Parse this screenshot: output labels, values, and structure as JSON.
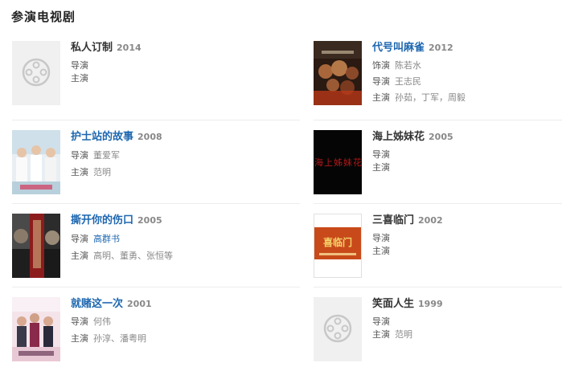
{
  "section": {
    "title": "参演电视剧"
  },
  "entries": [
    {
      "title": "私人订制",
      "year": "2014",
      "rows": [
        {
          "label": "导演",
          "value": ""
        },
        {
          "label": "主演",
          "value": ""
        }
      ]
    },
    {
      "title": "代号叫麻雀",
      "year": "2012",
      "rows": [
        {
          "label": "饰演",
          "value": "陈若水"
        },
        {
          "label": "导演",
          "value": "王志民"
        },
        {
          "label": "主演",
          "value": "孙茹，丁军，周毅"
        }
      ]
    },
    {
      "title": "护士站的故事",
      "year": "2008",
      "rows": [
        {
          "label": "导演",
          "value": "董爱军"
        },
        {
          "label": "主演",
          "value": "范明"
        }
      ]
    },
    {
      "title": "海上姊妹花",
      "year": "2005",
      "rows": [
        {
          "label": "导演",
          "value": ""
        },
        {
          "label": "主演",
          "value": ""
        }
      ]
    },
    {
      "title": "撕开你的伤口",
      "year": "2005",
      "rows": [
        {
          "label": "导演",
          "value": "高群书"
        },
        {
          "label": "主演",
          "value": "高明、董勇、张恒等"
        }
      ]
    },
    {
      "title": "三喜临门",
      "year": "2002",
      "rows": [
        {
          "label": "导演",
          "value": ""
        },
        {
          "label": "主演",
          "value": ""
        }
      ]
    },
    {
      "title": "就赌这一次",
      "year": "2001",
      "rows": [
        {
          "label": "导演",
          "value": "何伟"
        },
        {
          "label": "主演",
          "value": "孙淳、潘粤明"
        }
      ]
    },
    {
      "title": "笑面人生",
      "year": "1999",
      "rows": [
        {
          "label": "导演",
          "value": ""
        },
        {
          "label": "主演",
          "value": "范明"
        }
      ]
    }
  ],
  "poster_texts": {
    "haishang": "海上姊妹花",
    "sanxi": "喜临门"
  },
  "colors": {
    "link": "#1e67b0",
    "year": "#888888",
    "placeholder_bg": "#f0f0f0"
  }
}
